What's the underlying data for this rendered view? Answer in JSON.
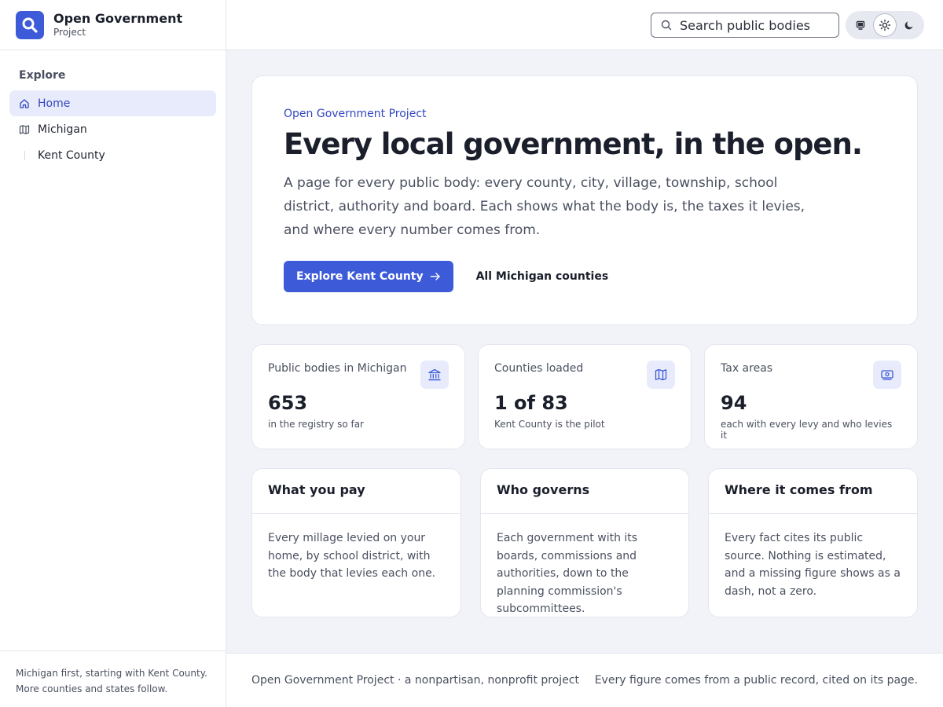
{
  "brand": {
    "title": "Open Government",
    "subtitle": "Project"
  },
  "nav": {
    "heading": "Explore",
    "items": [
      {
        "label": "Home",
        "icon": "home-icon",
        "active": true
      },
      {
        "label": "Michigan",
        "icon": "map-icon",
        "active": false
      },
      {
        "label": "Kent County",
        "icon": "",
        "active": false
      }
    ]
  },
  "sidebar_footer": {
    "line1": "Michigan first, starting with Kent County.",
    "line2": "More counties and states follow."
  },
  "search": {
    "placeholder": "Search public bodies",
    "value": ""
  },
  "theme": {
    "options": [
      "monitor-icon",
      "sun-icon",
      "moon-icon"
    ],
    "selected": "sun-icon"
  },
  "hero": {
    "kicker": "Open Government Project",
    "title": "Every local government, in the open.",
    "description": "A page for every public body: every county, city, village, township, school district, authority and board. Each shows what the body is, the taxes it levies, and where every number comes from.",
    "primary_button": "Explore Kent County",
    "secondary_link": "All Michigan counties"
  },
  "stats": [
    {
      "label": "Public bodies in Michigan",
      "value": "653",
      "note": "in the registry so far",
      "icon": "building-icon"
    },
    {
      "label": "Counties loaded",
      "value": "1 of 83",
      "note": "Kent County is the pilot",
      "icon": "map-icon"
    },
    {
      "label": "Tax areas",
      "value": "94",
      "note": "each with every levy and who levies it",
      "icon": "banknote-icon"
    }
  ],
  "features": [
    {
      "title": "What you pay",
      "body": "Every millage levied on your home, by school district, with the body that levies each one."
    },
    {
      "title": "Who governs",
      "body": "Each government with its boards, commissions and authorities, down to the planning commission's subcommittees."
    },
    {
      "title": "Where it comes from",
      "body": "Every fact cites its public source. Nothing is estimated, and a missing figure shows as a dash, not a zero."
    }
  ],
  "footer": {
    "left": "Open Government Project · a nonpartisan, nonprofit project",
    "right": "Every figure comes from a public record, cited on its page."
  },
  "colors": {
    "accent": "#3d5bd9",
    "accent_soft": "#e8ebfb",
    "background": "#f1f3f8"
  }
}
